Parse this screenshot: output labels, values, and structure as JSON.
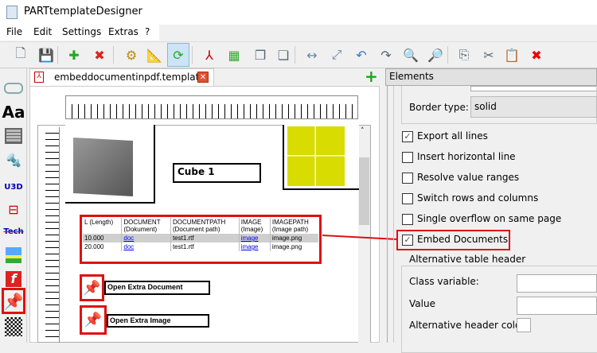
{
  "app": {
    "title": "PARTtemplateDesigner"
  },
  "menu": [
    "File",
    "Edit",
    "Settings",
    "Extras",
    "?"
  ],
  "toolbar": [
    "new-document-icon",
    "save-icon",
    "add-page-icon",
    "delete-page-icon",
    "settings-icon",
    "ruler-icon",
    "refresh-icon",
    "export-pdf-icon",
    "layers-icon",
    "bring-front-icon",
    "send-back-icon",
    "fit-width-icon",
    "fit-page-icon",
    "undo-icon",
    "redo-icon",
    "zoom-out-icon",
    "zoom-in-icon",
    "copy-icon",
    "cut-icon",
    "paste-icon",
    "delete-icon"
  ],
  "tab": {
    "label": "embeddocumentinpdf.template"
  },
  "canvas": {
    "cube_label": "Cube 1",
    "table": {
      "headers": [
        [
          "L (Length)",
          ""
        ],
        [
          "DOCUMENT",
          "(Dokument)"
        ],
        [
          "DOCUMENTPATH",
          "(Document path)"
        ],
        [
          "IMAGE",
          "(Image)"
        ],
        [
          "IMAGEPATH",
          "(Image path)"
        ]
      ],
      "rows": [
        [
          "10.000",
          "doc",
          "test1.rtf",
          "image",
          "image.png"
        ],
        [
          "20.000",
          "doc",
          "test1.rtf",
          "image",
          "image.png"
        ]
      ]
    },
    "pin1_label": "Open Extra Document",
    "pin2_label": "Open Extra Image"
  },
  "left_tools": {
    "text_tool": "Aa",
    "u3d": "U3D",
    "tech": "Tech"
  },
  "panel": {
    "title": "Elements",
    "border_type_label": "Border type:",
    "border_type_value": "solid",
    "checkboxes": [
      {
        "label": "Export all lines",
        "checked": true
      },
      {
        "label": "Insert horizontal line",
        "checked": false
      },
      {
        "label": "Resolve value ranges",
        "checked": false
      },
      {
        "label": "Switch rows and columns",
        "checked": false
      },
      {
        "label": "Single overflow on same page",
        "checked": false
      },
      {
        "label": "Embed Documents",
        "checked": true
      }
    ],
    "alt_header": {
      "title": "Alternative table header",
      "class_variable_label": "Class variable:",
      "value_label": "Value",
      "color_label": "Alternative header color:"
    }
  },
  "colors": {
    "highlight": "#e01010",
    "selected_tool": "#cce4f7",
    "yellow": "#d8dc00"
  }
}
